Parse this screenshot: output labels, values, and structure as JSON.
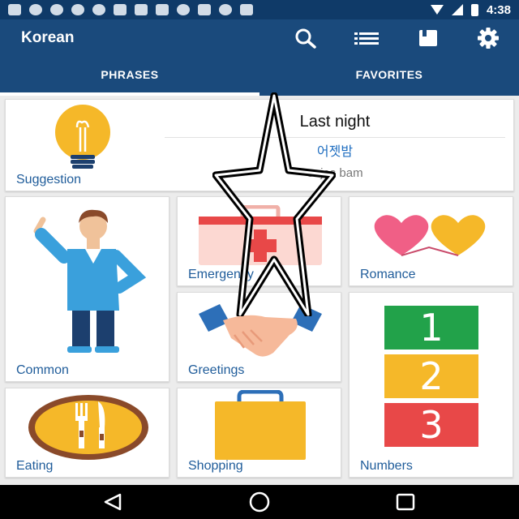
{
  "status_bar": {
    "time": "4:38"
  },
  "app_bar": {
    "title": "Korean",
    "icons": [
      "search-icon",
      "list-icon",
      "book-icon",
      "gear-icon"
    ]
  },
  "tabs": [
    {
      "label": "PHRASES",
      "active": true
    },
    {
      "label": "FAVORITES",
      "active": false
    }
  ],
  "suggestion": {
    "label": "Suggestion",
    "english": "Last night",
    "korean": "어젯밤",
    "romanization": "eojes bam"
  },
  "categories": [
    {
      "label": "Common"
    },
    {
      "label": "Emergency"
    },
    {
      "label": "Romance"
    },
    {
      "label": "Greetings"
    },
    {
      "label": "Numbers",
      "digits": [
        "1",
        "2",
        "3"
      ]
    },
    {
      "label": "Eating"
    },
    {
      "label": "Shopping"
    }
  ],
  "colors": {
    "header": "#1a4a7c",
    "status_bar": "#0f3a68",
    "label_text": "#1f5c9a",
    "korean_text": "#1f6ec0"
  }
}
